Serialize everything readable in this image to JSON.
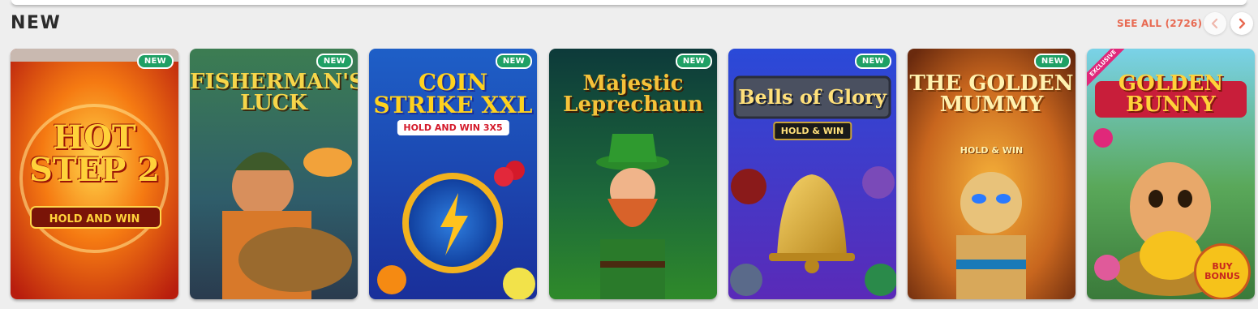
{
  "section": {
    "title": "NEW",
    "see_all_label": "SEE ALL (2726)"
  },
  "games": [
    {
      "title": "HOT STEP 2",
      "subtitle": "HOLD AND WIN",
      "badge": "NEW"
    },
    {
      "title": "FISHERMAN'S LUCK",
      "subtitle": "",
      "badge": "NEW"
    },
    {
      "title": "COIN STRIKE XXL",
      "subtitle": "HOLD AND WIN 3X5",
      "badge": "NEW"
    },
    {
      "title": "Majestic Leprechaun",
      "subtitle": "",
      "badge": "NEW"
    },
    {
      "title": "Bells of Glory",
      "subtitle": "HOLD & WIN",
      "badge": "NEW"
    },
    {
      "title": "THE GOLDEN MUMMY",
      "subtitle": "HOLD & WIN",
      "badge": "NEW"
    },
    {
      "title": "GOLDEN BUNNY",
      "subtitle": "",
      "badge": "",
      "ribbon": "EXCLUSIVE",
      "corner_badge": "BUY BONUS"
    }
  ],
  "icons": {
    "prev": "chevron-left-icon",
    "next": "chevron-right-icon"
  },
  "colors": {
    "accent": "#e86a52",
    "new_badge": "#1fa065",
    "title_text": "#2b2b2b"
  }
}
